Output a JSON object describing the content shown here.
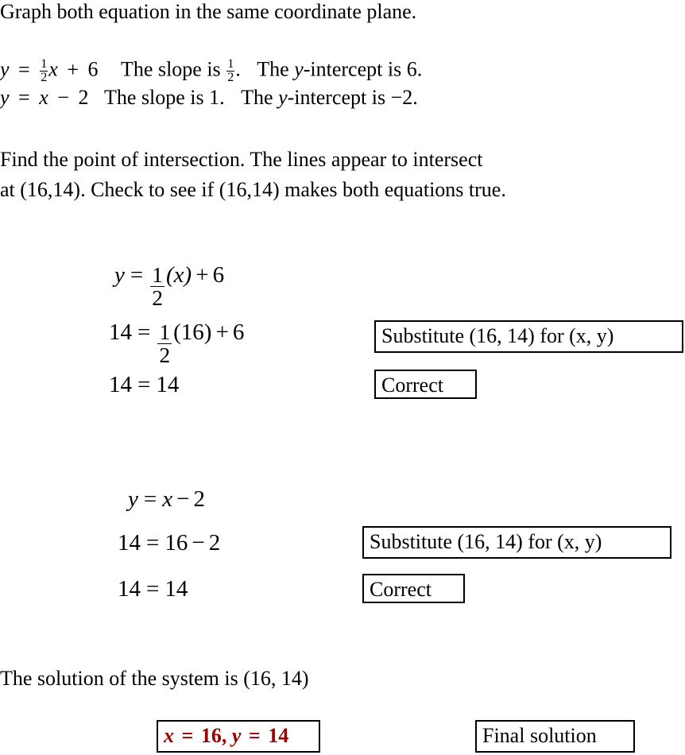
{
  "document": {
    "title": "Graph both equation in the same coordinate plane."
  },
  "intro": {
    "heading": "Graph both equation in the same coordinate plane.",
    "equation_1": {
      "lhs": "y",
      "equals": "=",
      "frac_num": "1",
      "frac_den": "2",
      "var": "x",
      "plus": "+",
      "constant": "6",
      "slope_prefix": "The slope is",
      "slope_num": "1",
      "slope_den": "2",
      "slope_period": ".",
      "intercept_prefix": "The",
      "intercept_var": "y",
      "intercept_suffix": "-intercept is 6."
    },
    "equation_2": {
      "lhs": "y",
      "equals": "=",
      "var": "x",
      "minus": "−",
      "constant": "2",
      "slope_text": "The slope is 1.",
      "intercept_prefix": "The",
      "intercept_var": "y",
      "intercept_suffix": "-intercept is −2."
    }
  },
  "instructions": {
    "line_1": "Find the point of intersection.  The lines appear to intersect",
    "line_2": "at (16,14).  Check to see if (16,14) makes both equations true."
  },
  "check_one": {
    "row_1": {
      "lhs": "y",
      "equals": "=",
      "frac_num": "1",
      "frac_den": "2",
      "paren": "(x)",
      "plus": "+",
      "constant": "6"
    },
    "row_2": {
      "lhs": "14",
      "equals": "=",
      "frac_num": "1",
      "frac_den": "2",
      "paren": "(16)",
      "plus": "+",
      "constant": "6"
    },
    "row_3": {
      "lhs": "14",
      "equals": "=",
      "rhs": "14"
    },
    "note_substitute": "Substitute (16, 14) for (x, y)",
    "note_correct": "Correct"
  },
  "check_two": {
    "row_1": {
      "lhs": "y",
      "equals": "=",
      "var": "x",
      "minus": "−",
      "constant": "2"
    },
    "row_2": {
      "lhs": "14",
      "equals": "=",
      "rhs_a": "16",
      "minus": "−",
      "rhs_b": "2"
    },
    "row_3": {
      "lhs": "14",
      "equals": "=",
      "rhs": "14"
    },
    "note_substitute": "Substitute (16, 14) for (x, y)",
    "note_correct": "Correct"
  },
  "conclusion": {
    "text": "The solution of the system is (16, 14)",
    "answer_x_var": "x",
    "answer_equals_1": "=",
    "answer_x_value": "16,",
    "answer_y_var": "y",
    "answer_equals_2": "=",
    "answer_y_value": "14",
    "note_final": "Final solution"
  },
  "colors": {
    "text": "#000000",
    "answer_red": "#990000",
    "background": "#ffffff"
  }
}
